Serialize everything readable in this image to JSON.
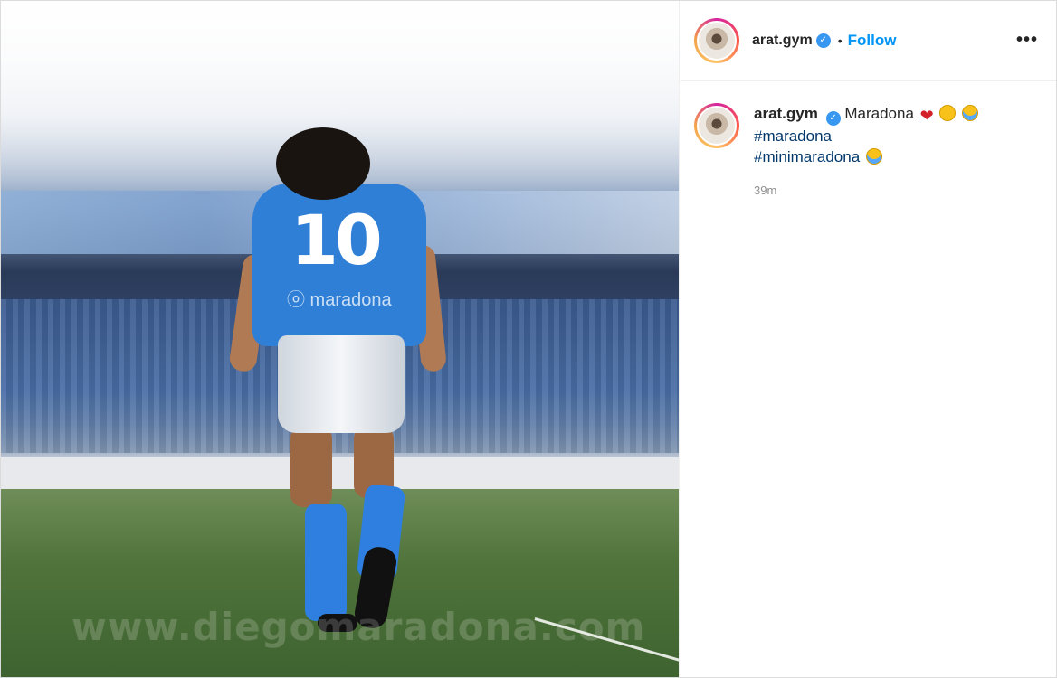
{
  "post": {
    "username": "arat.gym",
    "verified_icon": "verified-badge-icon",
    "separator": "•",
    "follow_label": "Follow",
    "more_icon": "more-options-icon",
    "more_label": "•••"
  },
  "media": {
    "jersey_number": "10",
    "shirt_tag": "ⓞ maradona",
    "watermark": "www.diegomaradona.com"
  },
  "caption": {
    "username": "arat.gym",
    "text": "Maradona",
    "hashtag_1": "#maradona",
    "hashtag_2": "#minimaradona",
    "emojis": [
      "broken-heart",
      "disappointed-face",
      "crying-face",
      "crying-face"
    ],
    "time": "39m"
  },
  "colors": {
    "follow": "#0095f6",
    "verified": "#3897f0",
    "hashtag": "#00376b",
    "time": "#8e8e8e"
  }
}
